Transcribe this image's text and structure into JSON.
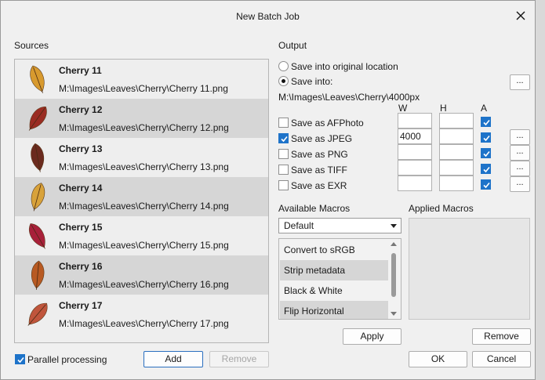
{
  "window": {
    "title": "New Batch Job"
  },
  "sources": {
    "label": "Sources",
    "items": [
      {
        "name": "Cherry 11",
        "path": "M:\\Images\\Leaves\\Cherry\\Cherry 11.png",
        "leaf_color": "#d89a2e"
      },
      {
        "name": "Cherry 12",
        "path": "M:\\Images\\Leaves\\Cherry\\Cherry 12.png",
        "leaf_color": "#9a2c22"
      },
      {
        "name": "Cherry 13",
        "path": "M:\\Images\\Leaves\\Cherry\\Cherry 13.png",
        "leaf_color": "#6b2a1e"
      },
      {
        "name": "Cherry 14",
        "path": "M:\\Images\\Leaves\\Cherry\\Cherry 14.png",
        "leaf_color": "#d8a23a"
      },
      {
        "name": "Cherry 15",
        "path": "M:\\Images\\Leaves\\Cherry\\Cherry 15.png",
        "leaf_color": "#a8203a"
      },
      {
        "name": "Cherry 16",
        "path": "M:\\Images\\Leaves\\Cherry\\Cherry 16.png",
        "leaf_color": "#b85a22"
      },
      {
        "name": "Cherry 17",
        "path": "M:\\Images\\Leaves\\Cherry\\Cherry 17.png",
        "leaf_color": "#c0553c"
      }
    ]
  },
  "output": {
    "label": "Output",
    "option_original": "Save into original location",
    "option_into": "Save into:",
    "selected_option": "into",
    "path": "M:\\Images\\Leaves\\Cherry\\4000px",
    "browse_label": "...",
    "col_w": "W",
    "col_h": "H",
    "col_a": "A",
    "formats": [
      {
        "label": "Save as AFPhoto",
        "checked": false,
        "w": "",
        "h": "",
        "a": true,
        "browse": false
      },
      {
        "label": "Save as JPEG",
        "checked": true,
        "w": "4000",
        "h": "",
        "a": true,
        "browse": true
      },
      {
        "label": "Save as PNG",
        "checked": false,
        "w": "",
        "h": "",
        "a": true,
        "browse": true
      },
      {
        "label": "Save as TIFF",
        "checked": false,
        "w": "",
        "h": "",
        "a": true,
        "browse": true
      },
      {
        "label": "Save as EXR",
        "checked": false,
        "w": "",
        "h": "",
        "a": true,
        "browse": true
      }
    ]
  },
  "macros": {
    "available_label": "Available Macros",
    "applied_label": "Applied Macros",
    "category": "Default",
    "items": [
      "Convert to sRGB",
      "Strip metadata",
      "Black & White",
      "Flip Horizontal"
    ],
    "apply_label": "Apply",
    "remove_label": "Remove"
  },
  "footer": {
    "parallel_label": "Parallel processing",
    "parallel_checked": true,
    "add_label": "Add",
    "remove_label": "Remove",
    "ok_label": "OK",
    "cancel_label": "Cancel"
  },
  "accent_color": "#1e73c9"
}
